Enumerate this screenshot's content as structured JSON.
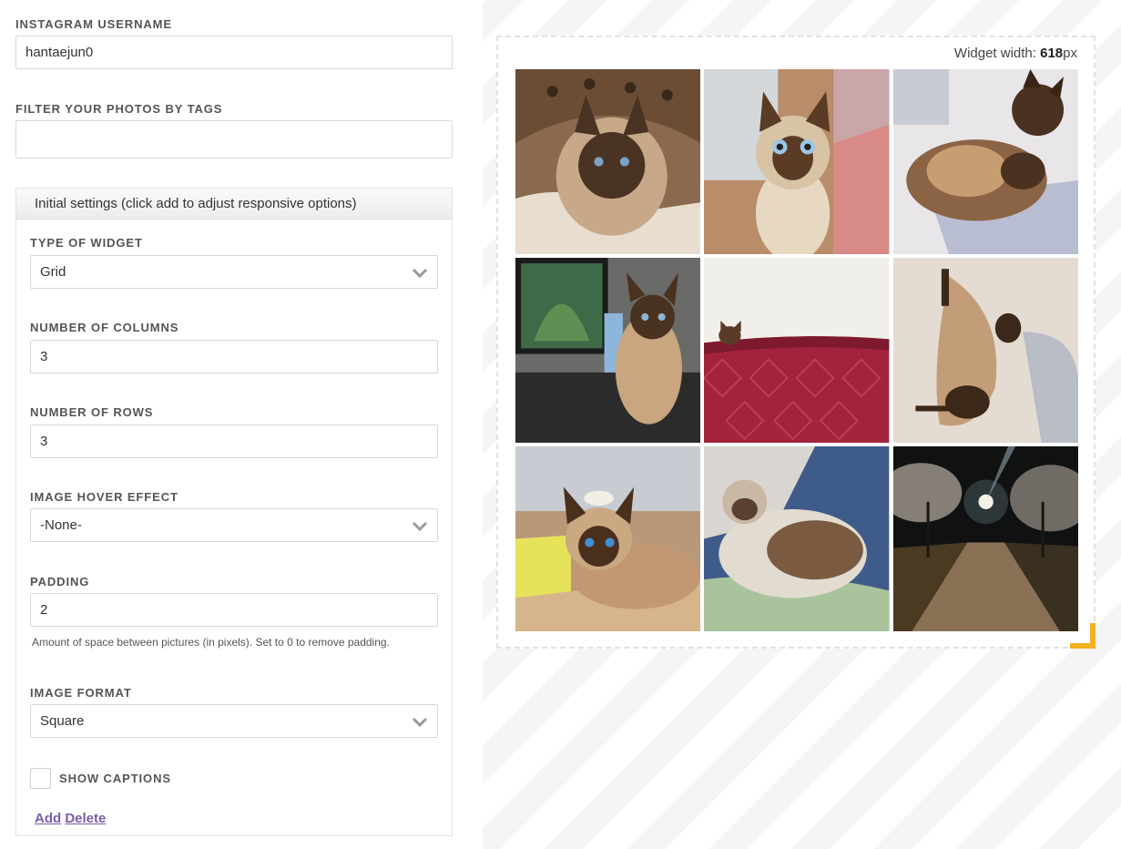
{
  "form": {
    "username": {
      "label": "INSTAGRAM USERNAME",
      "value": "hantaejun0"
    },
    "tags": {
      "label": "FILTER YOUR PHOTOS BY TAGS",
      "value": "",
      "placeholder": ""
    },
    "settings": {
      "header": "Initial settings (click add to adjust responsive options)",
      "widget_type": {
        "label": "TYPE OF WIDGET",
        "value": "Grid"
      },
      "columns": {
        "label": "NUMBER OF COLUMNS",
        "value": "3"
      },
      "rows": {
        "label": "NUMBER OF ROWS",
        "value": "3"
      },
      "hover_effect": {
        "label": "IMAGE HOVER EFFECT",
        "value": "-None-"
      },
      "padding": {
        "label": "PADDING",
        "value": "2",
        "hint": "Amount of space between pictures (in pixels). Set to 0 to remove padding."
      },
      "image_format": {
        "label": "IMAGE FORMAT",
        "value": "Square"
      },
      "show_captions": {
        "label": "SHOW CAPTIONS",
        "checked": false
      },
      "add_label": "Add",
      "delete_label": "Delete"
    }
  },
  "preview": {
    "width_prefix": "Widget width: ",
    "width_value": "618",
    "width_unit": "px",
    "photos": [
      {
        "subject": "siamese cat in leopard-print cat bed"
      },
      {
        "subject": "siamese cat with big blue eyes on wooden floor"
      },
      {
        "subject": "two siamese cats cuddling on grey cushion"
      },
      {
        "subject": "siamese cat on desk next to computer monitor"
      },
      {
        "subject": "siamese cat peeking over red quilted blanket"
      },
      {
        "subject": "siamese cat stretching on wooden floor"
      },
      {
        "subject": "siamese cat lying on table with bottle cap on head"
      },
      {
        "subject": "siamese cat curled on lap"
      },
      {
        "subject": "night path lined with cherry blossom trees"
      }
    ]
  },
  "colors": {
    "link": "#7b5da8",
    "handle": "#f5b21f",
    "border": "#d8d8d8",
    "label": "#555555"
  }
}
